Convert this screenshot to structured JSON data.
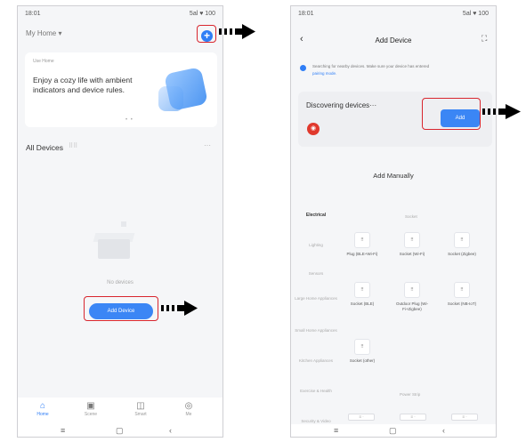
{
  "left_screen": {
    "status_time": "18:01",
    "status_icons": "5al ♥ 100",
    "home_name": "My Home ▾",
    "add_symbol": "+",
    "tip": {
      "tag": "Use Home",
      "text": "Enjoy a cozy life with ambient indicators and device rules.",
      "dots": "• •"
    },
    "section_title": "All Devices",
    "section_icon": "⠿⠿",
    "more": "···",
    "empty_text": "No devices",
    "add_device_button": "Add Device",
    "tabs": [
      {
        "icon": "⌂",
        "label": "Home"
      },
      {
        "icon": "▣",
        "label": "Scene"
      },
      {
        "icon": "◫",
        "label": "Smart"
      },
      {
        "icon": "◎",
        "label": "Me"
      }
    ],
    "nav": {
      "menu": "≡",
      "home": "▢",
      "back": "‹"
    }
  },
  "right_screen": {
    "status_time": "18:01",
    "status_icons": "5al ♥ 100",
    "back": "‹",
    "title": "Add Device",
    "scan_icon": "⛶",
    "search_text": "Searching for nearby devices. Make sure your device has entered",
    "search_link": "pairing mode.",
    "discovering_label": "Discovering devices···",
    "device_badge": "◉",
    "add_button": "Add",
    "add_manually": "Add Manually",
    "categories": [
      "Electrical",
      "Lighting",
      "Sensors",
      "Large Home Appliances",
      "Small Home Appliances",
      "Kitchen Appliances",
      "Exercise & Health",
      "Security & Video"
    ],
    "section_socket": "Socket",
    "section_power": "Power Strip",
    "products": [
      {
        "name": "Plug (BLE+Wi-Fi)"
      },
      {
        "name": "Socket (Wi-Fi)"
      },
      {
        "name": "Socket (Zigbee)"
      },
      {
        "name": "Socket (BLE)"
      },
      {
        "name": "Outdoor Plug (Wi-Fi+Zigbee)"
      },
      {
        "name": "Socket (NB-IoT)"
      },
      {
        "name": "Socket (other)"
      }
    ],
    "power_strip_items": [
      "≡ ·",
      "≡ ·",
      "≡ ·"
    ],
    "nav": {
      "menu": "≡",
      "home": "▢",
      "back": "‹"
    }
  }
}
